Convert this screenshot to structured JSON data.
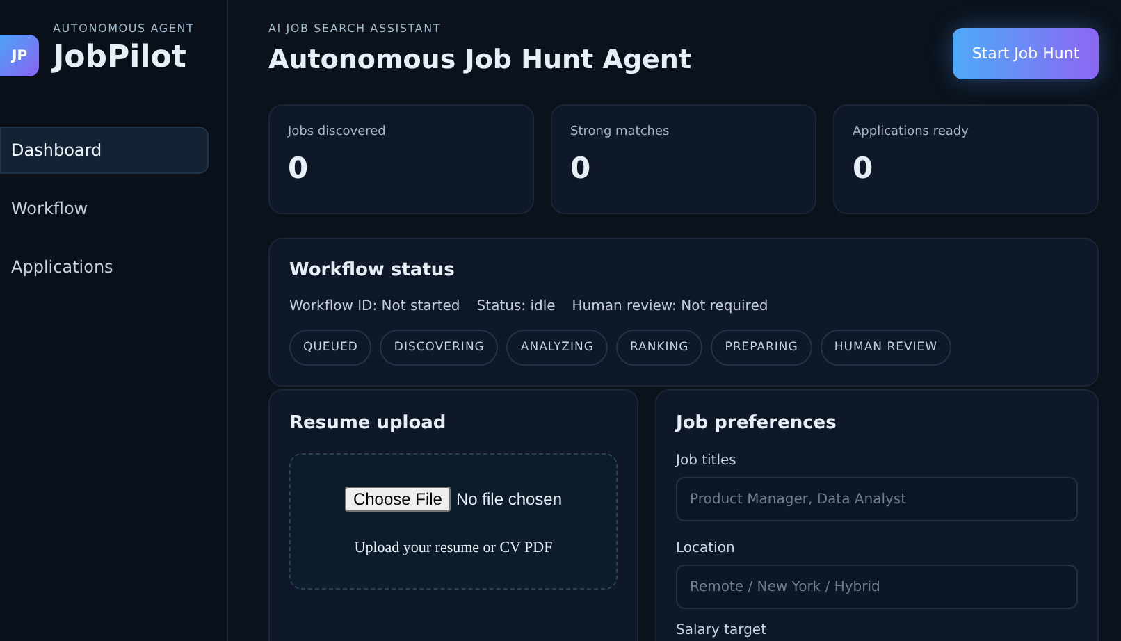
{
  "sidebar": {
    "logo": "JP",
    "eyebrow": "AUTONOMOUS AGENT",
    "brand": "JobPilot",
    "items": [
      {
        "label": "Dashboard",
        "selected": true
      },
      {
        "label": "Workflow",
        "selected": false
      },
      {
        "label": "Applications",
        "selected": false
      }
    ]
  },
  "header": {
    "eyebrow": "AI JOB SEARCH ASSISTANT",
    "title": "Autonomous Job Hunt Agent",
    "button": "Start Job Hunt"
  },
  "stats": [
    {
      "label": "Jobs discovered",
      "value": "0"
    },
    {
      "label": "Strong matches",
      "value": "0"
    },
    {
      "label": "Applications ready",
      "value": "0"
    }
  ],
  "workflow": {
    "title": "Workflow status",
    "meta": [
      "Workflow ID: Not started",
      "Status: idle",
      "Human review: Not required"
    ],
    "stages": [
      "QUEUED",
      "DISCOVERING",
      "ANALYZING",
      "RANKING",
      "PREPARING",
      "HUMAN REVIEW"
    ]
  },
  "resume": {
    "title": "Resume upload",
    "file_button": "Choose File",
    "file_status": "No file chosen",
    "hint": "Upload your resume or CV PDF"
  },
  "preferences": {
    "title": "Job preferences",
    "fields": [
      {
        "label": "Job titles",
        "placeholder": "Product Manager, Data Analyst"
      },
      {
        "label": "Location",
        "placeholder": "Remote / New York / Hybrid"
      }
    ],
    "next_label": "Salary target"
  }
}
